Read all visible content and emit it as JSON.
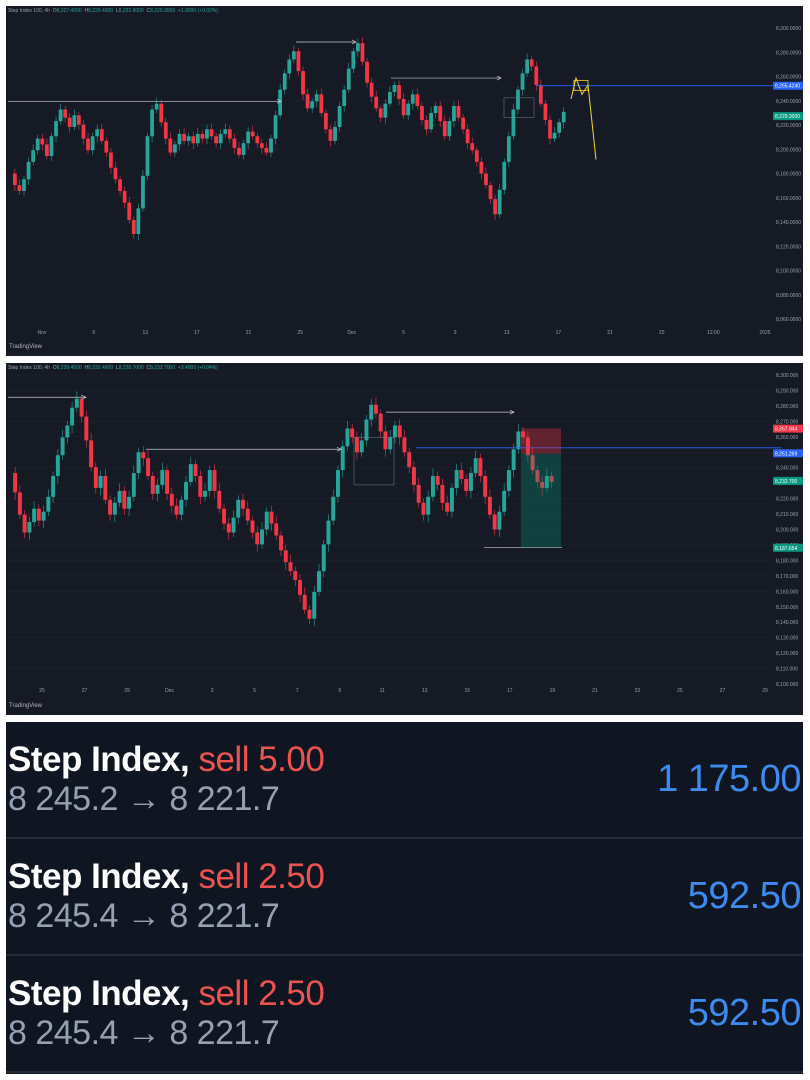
{
  "colors": {
    "up": "#26a69a",
    "down": "#f23645",
    "background": "#161a25",
    "grid": "#1f2330",
    "axis_text": "#9aa0ad",
    "blue_line": "#2962ff",
    "yellow_projection": "#f5d431"
  },
  "chart_data": [
    {
      "type": "candlestick",
      "title": "Step Index 100, 4h",
      "header_values": {
        "open": "8,227.4000",
        "high": "8,229.4000",
        "low": "8,222.8000",
        "close": "8,229.3000",
        "change": "+1.9000 (+0.02%)"
      },
      "y_ticks": [
        "8,300.0000",
        "8,280.0000",
        "8,260.0000",
        "8,240.0000",
        "8,220.0000",
        "8,200.0000",
        "8,180.0000",
        "8,160.0000",
        "8,140.0000",
        "8,120.0000",
        "8,100.0000",
        "8,080.0000",
        "8,060.0000"
      ],
      "ylim": [
        8055,
        8305
      ],
      "x_ticks": [
        "Nov",
        "9",
        "13",
        "17",
        "21",
        "25",
        "Dec",
        "5",
        "9",
        "13",
        "17",
        "21",
        "25",
        "12:00",
        "2025"
      ],
      "price_labels": [
        {
          "text": "8,255.4240",
          "value": 8255.4,
          "color": "#2962ff"
        },
        {
          "text": "8,229.3000",
          "value": 8229.3,
          "color": "#089981"
        }
      ],
      "horizontal_level": 8255.4,
      "close_series": [
        8180,
        8170,
        8165,
        8175,
        8190,
        8200,
        8210,
        8205,
        8195,
        8212,
        8225,
        8235,
        8228,
        8220,
        8230,
        8222,
        8210,
        8200,
        8212,
        8218,
        8208,
        8198,
        8185,
        8175,
        8165,
        8155,
        8140,
        8128,
        8150,
        8178,
        8212,
        8235,
        8240,
        8224,
        8210,
        8198,
        8205,
        8214,
        8208,
        8212,
        8206,
        8214,
        8210,
        8218,
        8212,
        8206,
        8214,
        8218,
        8210,
        8202,
        8196,
        8206,
        8216,
        8212,
        8206,
        8202,
        8198,
        8210,
        8230,
        8252,
        8266,
        8278,
        8285,
        8268,
        8248,
        8236,
        8242,
        8248,
        8232,
        8218,
        8208,
        8220,
        8238,
        8252,
        8270,
        8285,
        8292,
        8276,
        8258,
        8246,
        8236,
        8228,
        8240,
        8250,
        8256,
        8244,
        8230,
        8240,
        8248,
        8238,
        8226,
        8218,
        8232,
        8238,
        8225,
        8212,
        8225,
        8238,
        8228,
        8218,
        8206,
        8200,
        8190,
        8180,
        8170,
        8158,
        8145,
        8166,
        8190,
        8212,
        8235,
        8252,
        8266,
        8278,
        8272,
        8256,
        8240,
        8226,
        8210,
        8215,
        8224,
        8233
      ]
    },
    {
      "type": "candlestick",
      "title": "Step Index 100, 4h",
      "header_values": {
        "open": "8,229.4000",
        "high": "8,232.4000",
        "low": "8,228.7000",
        "close": "8,232.7000",
        "change": "+3.4000 (+0.04%)"
      },
      "y_ticks": [
        "8,300.000",
        "8,290.000",
        "8,280.000",
        "8,270.000",
        "8,260.000",
        "8,250.000",
        "8,240.000",
        "8,230.000",
        "8,220.000",
        "8,210.000",
        "8,200.000",
        "8,190.000",
        "8,180.000",
        "8,170.000",
        "8,160.000",
        "8,150.000",
        "8,140.000",
        "8,130.000",
        "8,120.000",
        "8,110.000",
        "8,100.000"
      ],
      "ylim": [
        8096,
        8304
      ],
      "x_ticks": [
        "25",
        "27",
        "29",
        "Dec",
        "3",
        "5",
        "7",
        "9",
        "11",
        "13",
        "15",
        "17",
        "19",
        "21",
        "23",
        "25",
        "27",
        "29"
      ],
      "price_labels": [
        {
          "text": "8,267.944",
          "value": 8267.9,
          "color": "#f23645"
        },
        {
          "text": "8,251.269",
          "value": 8251.3,
          "color": "#2962ff"
        },
        {
          "text": "8,232.700",
          "value": 8232.7,
          "color": "#089981"
        },
        {
          "text": "8,187.654",
          "value": 8187.7,
          "color": "#089981"
        }
      ],
      "horizontal_level": 8255.0,
      "close_series": [
        8238,
        8225,
        8210,
        8198,
        8205,
        8214,
        8206,
        8212,
        8222,
        8236,
        8250,
        8262,
        8270,
        8282,
        8288,
        8276,
        8260,
        8242,
        8228,
        8236,
        8220,
        8210,
        8218,
        8226,
        8214,
        8222,
        8238,
        8252,
        8248,
        8236,
        8224,
        8230,
        8240,
        8224,
        8216,
        8210,
        8220,
        8232,
        8244,
        8236,
        8222,
        8226,
        8240,
        8226,
        8214,
        8204,
        8198,
        8208,
        8220,
        8214,
        8206,
        8198,
        8190,
        8200,
        8212,
        8204,
        8196,
        8186,
        8178,
        8172,
        8166,
        8156,
        8146,
        8140,
        8158,
        8172,
        8190,
        8206,
        8222,
        8240,
        8256,
        8268,
        8262,
        8252,
        8260,
        8274,
        8284,
        8278,
        8266,
        8254,
        8262,
        8270,
        8262,
        8252,
        8242,
        8230,
        8218,
        8210,
        8222,
        8236,
        8230,
        8218,
        8212,
        8228,
        8240,
        8234,
        8226,
        8238,
        8248,
        8236,
        8222,
        8210,
        8200,
        8212,
        8226,
        8240,
        8254,
        8266,
        8262,
        8250,
        8240,
        8232,
        8228,
        8236,
        8232
      ]
    }
  ],
  "trades": [
    {
      "symbol": "Step Index,",
      "side": "sell 5.00",
      "prices": "8 245.2 → 8 221.7",
      "pnl": "1 175.00"
    },
    {
      "symbol": "Step Index,",
      "side": "sell 2.50",
      "prices": "8 245.4 → 8 221.7",
      "pnl": "592.50"
    },
    {
      "symbol": "Step Index,",
      "side": "sell 2.50",
      "prices": "8 245.4 → 8 221.7",
      "pnl": "592.50"
    }
  ],
  "brand": "TradingView"
}
